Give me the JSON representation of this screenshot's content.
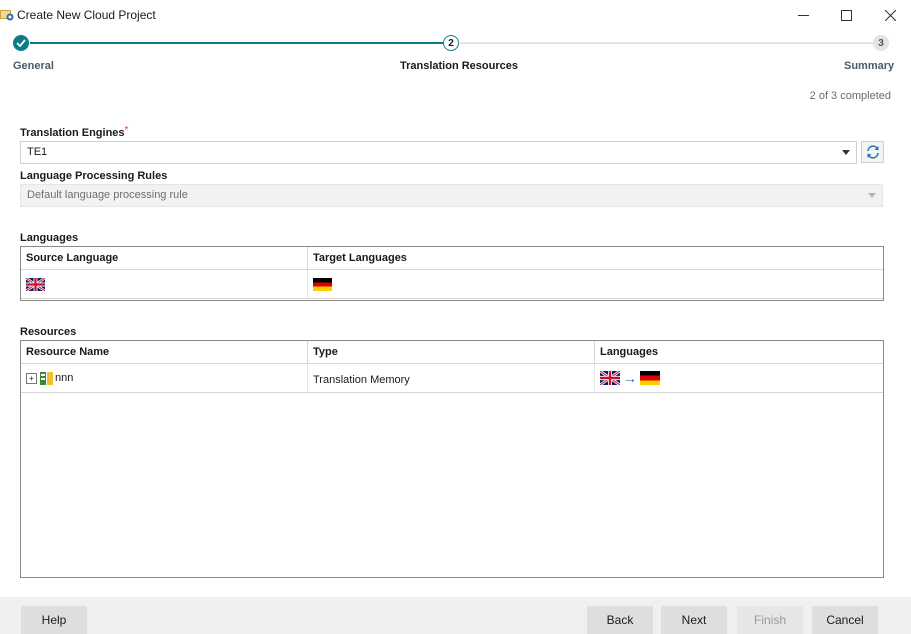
{
  "window": {
    "title": "Create New Cloud Project",
    "icon": "cloud-project-icon"
  },
  "stepper": {
    "steps": [
      {
        "number": "",
        "label": "General",
        "state": "completed"
      },
      {
        "number": "2",
        "label": "Translation Resources",
        "state": "current"
      },
      {
        "number": "3",
        "label": "Summary",
        "state": "pending"
      }
    ],
    "progress_text": "2 of 3 completed",
    "accent_color": "#0e7c86"
  },
  "form": {
    "translation_engines": {
      "label": "Translation Engines",
      "required_marker": "*",
      "value": "TE1"
    },
    "language_processing_rules": {
      "label": "Language Processing Rules",
      "value": "Default language processing rule"
    }
  },
  "languages": {
    "label": "Languages",
    "columns": [
      "Source Language",
      "Target Languages"
    ],
    "rows": [
      {
        "source_flag": "flag-uk",
        "target_flag": "flag-de"
      }
    ]
  },
  "resources": {
    "label": "Resources",
    "columns": [
      "Resource Name",
      "Type",
      "Languages"
    ],
    "rows": [
      {
        "expander": "+",
        "name": "nnn",
        "type": "Translation Memory",
        "source_flag": "flag-uk",
        "arrow": "→",
        "target_flag": "flag-de"
      }
    ]
  },
  "footer": {
    "help": "Help",
    "back": "Back",
    "next": "Next",
    "finish": "Finish",
    "cancel": "Cancel"
  }
}
